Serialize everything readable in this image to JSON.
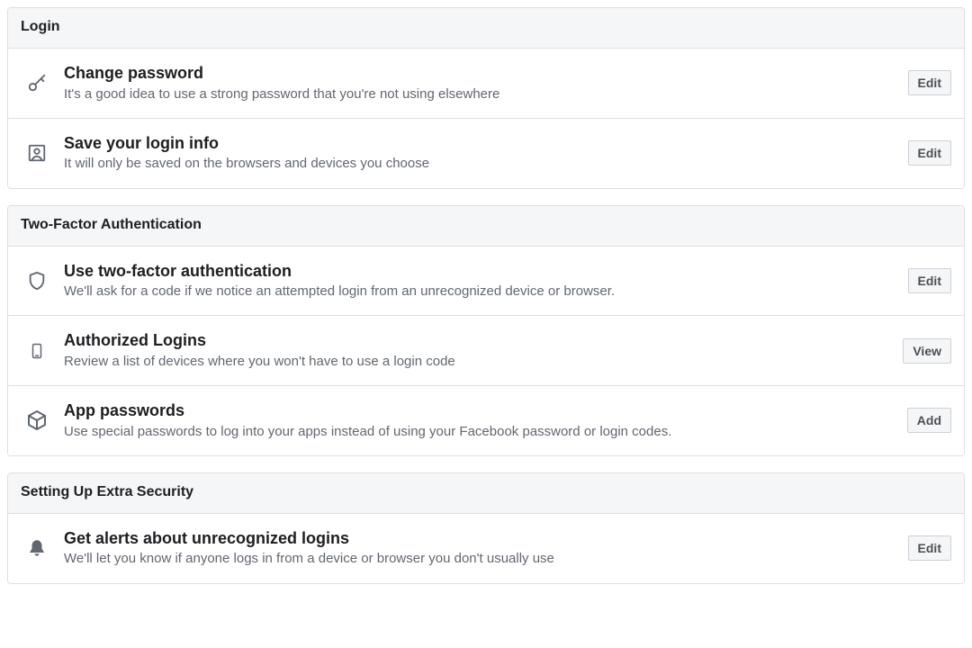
{
  "sections": {
    "login": {
      "header": "Login",
      "rows": {
        "change_password": {
          "title": "Change password",
          "desc": "It's a good idea to use a strong password that you're not using elsewhere",
          "action": "Edit"
        },
        "save_login_info": {
          "title": "Save your login info",
          "desc": "It will only be saved on the browsers and devices you choose",
          "action": "Edit"
        }
      }
    },
    "two_factor": {
      "header": "Two-Factor Authentication",
      "rows": {
        "use_2fa": {
          "title": "Use two-factor authentication",
          "desc": "We'll ask for a code if we notice an attempted login from an unrecognized device or browser.",
          "action": "Edit"
        },
        "authorized_logins": {
          "title": "Authorized Logins",
          "desc": "Review a list of devices where you won't have to use a login code",
          "action": "View"
        },
        "app_passwords": {
          "title": "App passwords",
          "desc": "Use special passwords to log into your apps instead of using your Facebook password or login codes.",
          "action": "Add"
        }
      }
    },
    "extra_security": {
      "header": "Setting Up Extra Security",
      "rows": {
        "login_alerts": {
          "title": "Get alerts about unrecognized logins",
          "desc": "We'll let you know if anyone logs in from a device or browser you don't usually use",
          "action": "Edit"
        }
      }
    }
  }
}
